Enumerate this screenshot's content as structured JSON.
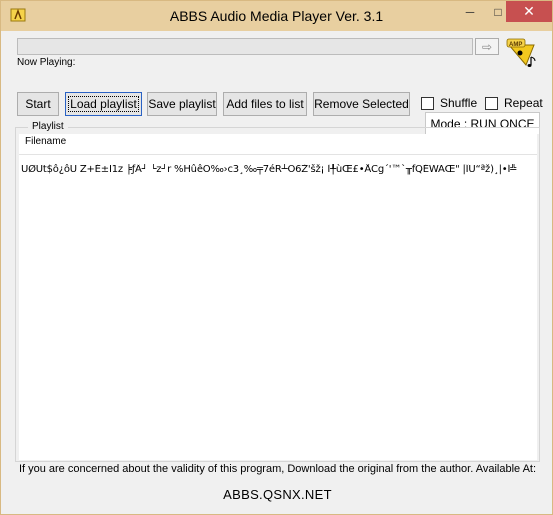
{
  "window": {
    "title": "ABBS Audio Media Player Ver. 3.1",
    "minimize_glyph": "─",
    "maximize_glyph": "□",
    "close_glyph": "✕",
    "title_icon": "app-icon",
    "accent_close": "#c75050",
    "frame_color": "#e8cfa0"
  },
  "player": {
    "now_playing_label": "Now Playing:",
    "arrow_glyph": "⇨",
    "logo": "amp-music-logo"
  },
  "toolbar": {
    "start": "Start",
    "load_playlist": "Load playlist",
    "save_playlist": "Save playlist",
    "add_files": "Add files to list",
    "remove_selected": "Remove Selected",
    "shuffle": "Shuffle",
    "repeat": "Repeat"
  },
  "mode": {
    "label": "Mode : RUN ONCE"
  },
  "playlist": {
    "group_label": "Playlist",
    "column_header": "Filename",
    "rows": [
      "ÛØÙt$ô¿ôÙ Z+É±I1z ╞ƒÂ┘ └z┘r   %HûêÖ‰›c3¸‰╤7éR┴Ö6Ž'šž¡ Ì╀ùŒ£•ÅCg´'™`╥fQÉWÄŒ\" |ÎÛ“ªž)¸|•Í╩"
    ]
  },
  "footer": {
    "note": "If you are concerned about the validity of this program, Download the original from the author.  Available At:",
    "site": "ABBS.QSNX.NET"
  }
}
